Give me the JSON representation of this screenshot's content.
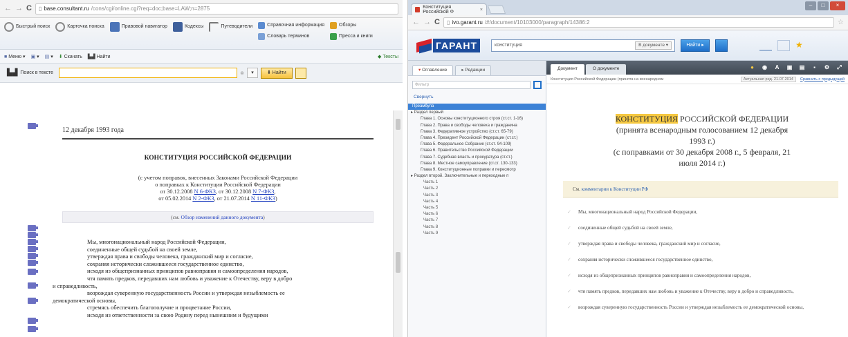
{
  "left": {
    "url_host": "base.consultant.ru",
    "url_path": "/cons/cgi/online.cgi?req=doc;base=LAW;n=2875",
    "toolbar": {
      "items": [
        {
          "label": "Быстрый поиск"
        },
        {
          "label": "Карточка поиска"
        },
        {
          "label": "Правовой навигатор"
        },
        {
          "label": "Кодексы"
        },
        {
          "label": "Путеводители"
        },
        {
          "label": "Справочная информация"
        },
        {
          "label": "Обзоры"
        },
        {
          "label": "Словарь терминов"
        },
        {
          "label": "Пресса и книги"
        }
      ]
    },
    "toolbar2": {
      "items": [
        "Меню",
        "Сохранить",
        "Сохранить",
        "Скачать",
        "Найти"
      ],
      "right": "Тексты"
    },
    "search": {
      "label": "Поиск в тексте",
      "find_button": "Найти"
    },
    "doc": {
      "date": "12 декабря 1993 года",
      "title": "КОНСТИТУЦИЯ РОССИЙСКОЙ ФЕДЕРАЦИИ",
      "note1": "(с учетом поправок, внесенных Законами Российской Федерации",
      "note2": "о поправках к Конституции Российской Федерации",
      "note3_pre": "от 30.12.2008 ",
      "note3_l1": "N 6-ФКЗ",
      "note3_mid": ", от 30.12.2008 ",
      "note3_l2": "N 7-ФКЗ",
      "note3_post": ",",
      "note4_pre": "от 05.02.2014 ",
      "note4_l1": "N 2-ФКЗ",
      "note4_mid": ", от 21.07.2014 ",
      "note4_l2": "N 11-ФКЗ",
      "note4_post": ")",
      "box_pre": "(см. ",
      "box_link": "Обзор изменений данного документа",
      "box_post": ")",
      "body": [
        "Мы, многонациональный народ Российской Федерации,",
        "соединенные общей судьбой на своей земле,",
        "утверждая права и свободы человека, гражданский мир и согласие,",
        "сохраняя исторически сложившееся государственное единство,",
        "исходя из общепризнанных принципов равноправия и самоопределения народов,",
        "чтя память предков, передавших нам любовь и уважение к Отечеству, веру в добро",
        "и справедливость,",
        "возрождая суверенную государственность России и утверждая незыблемость ее",
        "демократической основы,",
        "стремясь обеспечить благополучие и процветание России,",
        "исходя из ответственности за свою Родину перед нынешним и будущими"
      ]
    }
  },
  "right": {
    "tab_title": "Конституция Российской Ф",
    "url_host": "ivo.garant.ru",
    "url_path": "/#/document/10103000/paragraph/14386:2",
    "logo": "ГАРАНТ",
    "search_value": "конституция",
    "search_count": "В документе",
    "find_button": "Найти",
    "side": {
      "tabs": [
        "Оглавление",
        "Редакции"
      ],
      "filter_placeholder": "Фильтр",
      "link": "Свернуть",
      "tree": [
        {
          "t": "Преамбула",
          "sel": true
        },
        {
          "t": "Раздел первый",
          "lvl": 1
        },
        {
          "t": "Глава 1. Основы конституционного строя (ст.ст. 1-16)"
        },
        {
          "t": "Глава 2. Права и свободы человека и гражданина"
        },
        {
          "t": "Глава 3. Федеративное устройство (ст.ст. 65-79)"
        },
        {
          "t": "Глава 4. Президент Российской Федерации (ст.ст.)"
        },
        {
          "t": "Глава 5. Федеральное Собрание (ст.ст. 94-109)"
        },
        {
          "t": "Глава 6. Правительство Российской Федерации"
        },
        {
          "t": "Глава 7. Судебная власть и прокуратура (ст.ст.)"
        },
        {
          "t": "Глава 8. Местное самоуправление (ст.ст. 130-133)"
        },
        {
          "t": "Глава 9. Конституционные поправки и пересмотр"
        },
        {
          "t": "Раздел второй. Заключительные и переходные п",
          "lvl": 1
        },
        {
          "t": "Часть 1",
          "part": true
        },
        {
          "t": "Часть 2",
          "part": true
        },
        {
          "t": "Часть 3",
          "part": true
        },
        {
          "t": "Часть 4",
          "part": true
        },
        {
          "t": "Часть 5",
          "part": true
        },
        {
          "t": "Часть 6",
          "part": true
        },
        {
          "t": "Часть 7",
          "part": true
        },
        {
          "t": "Часть 8",
          "part": true
        },
        {
          "t": "Часть 9",
          "part": true
        }
      ]
    },
    "main": {
      "tabs": [
        "Документ",
        "О документе"
      ],
      "breadcrumb": "Конституция Российской Федерации (принята на всенародном",
      "edition": "Актуальная ред. 21.07.2014",
      "changes": "Сравнить с предыдущей",
      "title_hl": "КОНСТИТУЦИЯ",
      "title_rest": " РОССИЙСКОЙ ФЕДЕРАЦИИ",
      "title_l2": "(принята всенародным голосованием 12 декабря",
      "title_l3": "1993 г.)",
      "title_l4": "(с поправками от 30 декабря 2008 г., 5 февраля, 21",
      "title_l5": "июля 2014 г.)",
      "comment_pre": "См. ",
      "comment_link": "комментарии к Конституции РФ",
      "list": [
        "Мы, многонациональный народ Российской Федерации,",
        "соединенные общей судьбой на своей земле,",
        "утверждая права и свободы человека, гражданский мир и согласие,",
        "сохраняя исторически сложившееся государственное единство,",
        "исходя из общепризнанных принципов равноправия и самоопределения народов,",
        "чтя память предков, передавших нам любовь и уважение к Отечеству, веру в добро и справедливость,",
        "возрождая суверенную государственность России и утверждая незыблемость ее демократической основы,"
      ]
    }
  },
  "colors": {
    "consultant_marker": "#6a6fc2",
    "garant_red": "#d8232a",
    "garant_blue": "#1c4c9c",
    "highlight": "#f5c842",
    "selection": "#3c82d6"
  }
}
